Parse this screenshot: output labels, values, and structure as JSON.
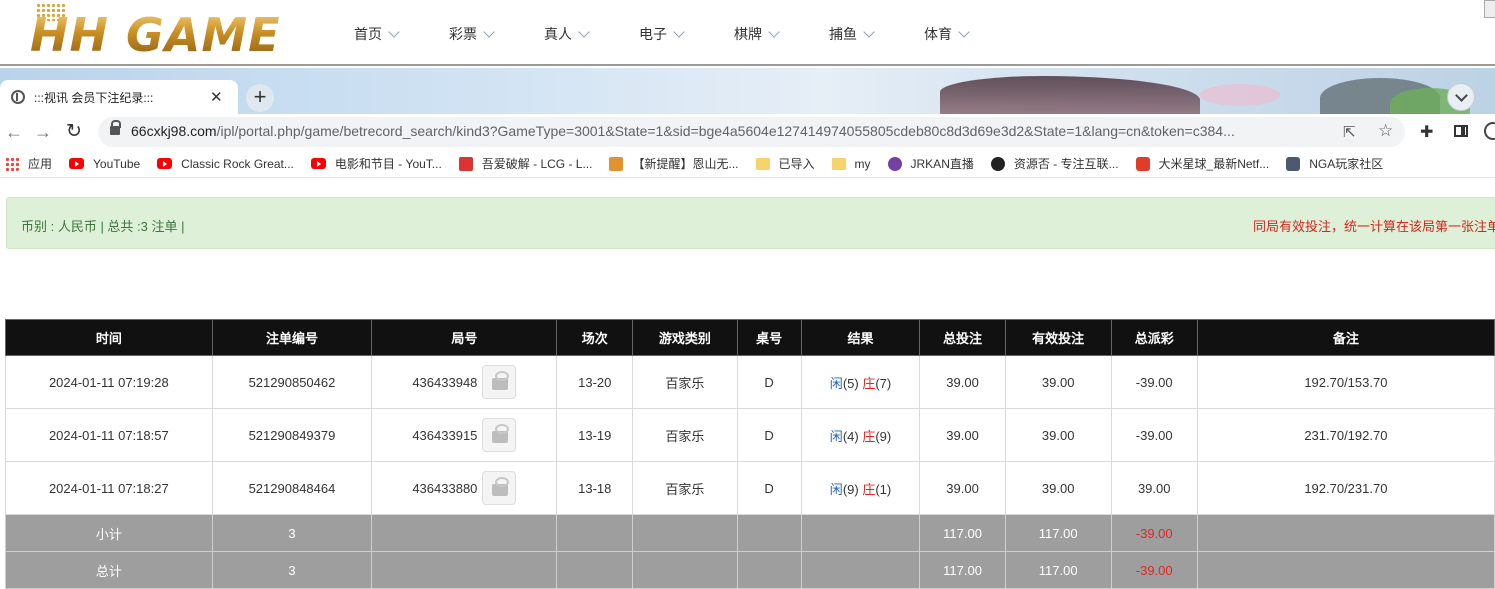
{
  "site": {
    "logo_text": "HH GAME",
    "nav": [
      "首页",
      "彩票",
      "真人",
      "电子",
      "棋牌",
      "捕鱼",
      "体育"
    ]
  },
  "browser": {
    "tab_title": ":::视讯 会员下注纪录:::",
    "url_host": "66cxkj98.com",
    "url_path": "/ipl/portal.php/game/betrecord_search/kind3?GameType=3001&State=1&sid=bge4a5604e127414974055805cdeb80c8d3d69e3d2&State=1&lang=cn&token=c384...",
    "bookmarks": [
      {
        "label": "应用",
        "icon": "apps-grid-icon"
      },
      {
        "label": "YouTube",
        "icon": "youtube-icon"
      },
      {
        "label": "Classic Rock Great...",
        "icon": "youtube-icon"
      },
      {
        "label": "电影和节目 - YouT...",
        "icon": "youtube-icon"
      },
      {
        "label": "吾爱破解 - LCG - L...",
        "icon": "site-icon"
      },
      {
        "label": "【新提醒】恩山无...",
        "icon": "site-icon"
      },
      {
        "label": "已导入",
        "icon": "folder-icon"
      },
      {
        "label": "my",
        "icon": "folder-icon"
      },
      {
        "label": "JRKAN直播",
        "icon": "site-icon"
      },
      {
        "label": "资源否 - 专注互联...",
        "icon": "site-icon"
      },
      {
        "label": "大米星球_最新Netf...",
        "icon": "site-icon"
      },
      {
        "label": "NGA玩家社区",
        "icon": "site-icon"
      }
    ]
  },
  "info": {
    "summary": "币别 : 人民币 | 总共 :3 注单 |",
    "notice": "同局有效投注，统一计算在该局第一张注单"
  },
  "table": {
    "headers": [
      "时间",
      "注单编号",
      "局号",
      "场次",
      "游戏类别",
      "桌号",
      "结果",
      "总投注",
      "有效投注",
      "总派彩",
      "备注"
    ],
    "rows": [
      {
        "time": "2024-01-11 07:19:28",
        "bet_id": "521290850462",
        "round": "436433948",
        "session": "13-20",
        "game": "百家乐",
        "table": "D",
        "player_label": "闲",
        "player_score": "(5)",
        "banker_label": "庄",
        "banker_score": "(7)",
        "total_bet": "39.00",
        "valid_bet": "39.00",
        "payout": "-39.00",
        "note": "192.70/153.70"
      },
      {
        "time": "2024-01-11 07:18:57",
        "bet_id": "521290849379",
        "round": "436433915",
        "session": "13-19",
        "game": "百家乐",
        "table": "D",
        "player_label": "闲",
        "player_score": "(4)",
        "banker_label": "庄",
        "banker_score": "(9)",
        "total_bet": "39.00",
        "valid_bet": "39.00",
        "payout": "-39.00",
        "note": "231.70/192.70"
      },
      {
        "time": "2024-01-11 07:18:27",
        "bet_id": "521290848464",
        "round": "436433880",
        "session": "13-18",
        "game": "百家乐",
        "table": "D",
        "player_label": "闲",
        "player_score": "(9)",
        "banker_label": "庄",
        "banker_score": "(1)",
        "total_bet": "39.00",
        "valid_bet": "39.00",
        "payout": "39.00",
        "note": "192.70/231.70"
      }
    ],
    "subtotal": {
      "label": "小计",
      "count": "3",
      "total_bet": "117.00",
      "valid_bet": "117.00",
      "payout": "-39.00"
    },
    "total": {
      "label": "总计",
      "count": "3",
      "total_bet": "117.00",
      "valid_bet": "117.00",
      "payout": "-39.00"
    }
  },
  "colors": {
    "info_bg": "#dff0d8",
    "info_text": "#3c763d",
    "notice_text": "#d9241a",
    "header_bg": "#111111",
    "sum_bg": "#9e9e9e",
    "negative": "#e8241d",
    "link_blue": "#2166bd"
  }
}
